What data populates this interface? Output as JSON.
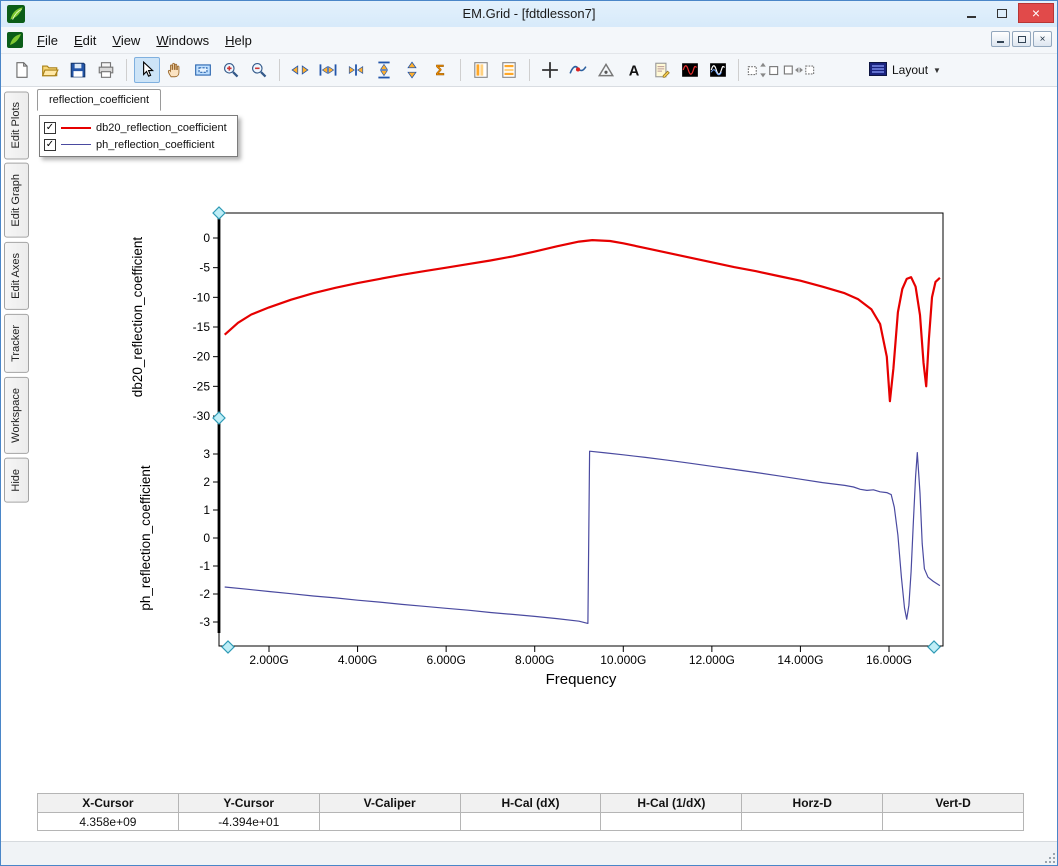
{
  "window": {
    "title": "EM.Grid - [fdtdlesson7]",
    "close_glyph": "×",
    "controls": [
      "minimize-icon",
      "maximize-icon",
      "close-icon"
    ],
    "mdi_controls": [
      "minimize-icon",
      "restore-icon",
      "close-icon"
    ]
  },
  "menu": {
    "items": [
      "File",
      "Edit",
      "View",
      "Windows",
      "Help"
    ]
  },
  "toolbar": {
    "layout_label": "Layout",
    "icons": [
      {
        "name": "new-file-icon",
        "kind": "new"
      },
      {
        "name": "open-file-icon",
        "kind": "open"
      },
      {
        "name": "save-icon",
        "kind": "save"
      },
      {
        "name": "print-icon",
        "kind": "print"
      },
      {
        "kind": "sep"
      },
      {
        "name": "select-cursor-icon",
        "kind": "cursor",
        "selected": true
      },
      {
        "name": "pan-hand-icon",
        "kind": "hand"
      },
      {
        "name": "zoom-region-icon",
        "kind": "zoomrect"
      },
      {
        "name": "zoom-in-icon",
        "kind": "zoomin"
      },
      {
        "name": "zoom-out-icon",
        "kind": "zoomout"
      },
      {
        "kind": "sep"
      },
      {
        "name": "fit-horizontal-icon",
        "kind": "harrow"
      },
      {
        "name": "expand-horizontal-icon",
        "kind": "harrowbars"
      },
      {
        "name": "collapse-horizontal-icon",
        "kind": "harrowedge"
      },
      {
        "name": "expand-vertical-icon",
        "kind": "vexpand"
      },
      {
        "name": "fit-vertical-icon",
        "kind": "varrow"
      },
      {
        "name": "autoscale-sigma-icon",
        "kind": "sigma"
      },
      {
        "kind": "sep"
      },
      {
        "name": "column-layout-icon",
        "kind": "coldoc"
      },
      {
        "name": "row-layout-icon",
        "kind": "rowdoc"
      },
      {
        "kind": "sep"
      },
      {
        "name": "crosshair-icon",
        "kind": "cross"
      },
      {
        "name": "curve-marker-icon",
        "kind": "curve"
      },
      {
        "name": "delta-marker-icon",
        "kind": "tri"
      },
      {
        "name": "text-annotation-icon",
        "kind": "textA"
      },
      {
        "name": "notes-icon",
        "kind": "note"
      },
      {
        "name": "dark-trace-red-icon",
        "kind": "waveR"
      },
      {
        "name": "dark-trace-white-icon",
        "kind": "waveW"
      },
      {
        "kind": "sep"
      },
      {
        "name": "vertical-span-boxes-icon",
        "kind": "checkv"
      },
      {
        "name": "horizontal-span-boxes-icon",
        "kind": "checkh"
      },
      {
        "kind": "gap"
      },
      {
        "name": "layout-dropdown",
        "kind": "layout"
      }
    ]
  },
  "sidebar": {
    "tabs": [
      {
        "label": "Edit Plots",
        "name": "sidebar-tab-edit-plots"
      },
      {
        "label": "Edit Graph",
        "name": "sidebar-tab-edit-graph"
      },
      {
        "label": "Edit Axes",
        "name": "sidebar-tab-edit-axes"
      },
      {
        "label": "Tracker",
        "name": "sidebar-tab-tracker"
      },
      {
        "label": "Workspace",
        "name": "sidebar-tab-workspace"
      },
      {
        "label": "Hide",
        "name": "sidebar-tab-hide"
      }
    ]
  },
  "tabs": {
    "active": "reflection_coefficient"
  },
  "legend": {
    "entries": [
      {
        "label": "db20_reflection_coefficient",
        "color": "#e60000",
        "checked": true,
        "line_width": 2.5,
        "check_glyph": "✓"
      },
      {
        "label": "ph_reflection_coefficient",
        "color": "#4a4aa0",
        "checked": true,
        "line_width": 1.3,
        "check_glyph": "✓"
      }
    ]
  },
  "chart_data": {
    "type": "line",
    "x_axis": {
      "label": "Frequency",
      "tick_labels": [
        "2.000G",
        "4.000G",
        "6.000G",
        "8.000G",
        "10.000G",
        "12.000G",
        "14.000G",
        "16.000G"
      ],
      "tick_values_ghz": [
        2,
        4,
        6,
        8,
        10,
        12,
        14,
        16
      ],
      "range_ghz": [
        0.87,
        17.22
      ]
    },
    "panels": [
      {
        "ylabel": "db20_reflection_coefficient",
        "yticks": [
          0,
          -5,
          -10,
          -15,
          -20,
          -25,
          -30
        ],
        "ylim": [
          -30,
          2
        ]
      },
      {
        "ylabel": "ph_reflection_coefficient",
        "yticks": [
          3,
          2,
          1,
          0,
          -1,
          -2,
          -3
        ],
        "ylim": [
          -3.5,
          3.5
        ]
      }
    ],
    "series": [
      {
        "name": "db20_reflection_coefficient",
        "panel": 0,
        "color": "#e60000",
        "width": 2.2,
        "points": [
          [
            1.0,
            -16.3
          ],
          [
            1.3,
            -14.3
          ],
          [
            1.6,
            -12.9
          ],
          [
            2.0,
            -11.7
          ],
          [
            2.5,
            -10.4
          ],
          [
            3.0,
            -9.3
          ],
          [
            3.5,
            -8.4
          ],
          [
            4.0,
            -7.6
          ],
          [
            4.5,
            -6.9
          ],
          [
            5.0,
            -6.2
          ],
          [
            5.5,
            -5.6
          ],
          [
            6.0,
            -5.0
          ],
          [
            6.5,
            -4.4
          ],
          [
            7.0,
            -3.8
          ],
          [
            7.5,
            -3.1
          ],
          [
            8.0,
            -2.3
          ],
          [
            8.5,
            -1.4
          ],
          [
            9.0,
            -0.6
          ],
          [
            9.3,
            -0.35
          ],
          [
            9.7,
            -0.5
          ],
          [
            10.0,
            -0.9
          ],
          [
            10.5,
            -1.7
          ],
          [
            11.0,
            -2.5
          ],
          [
            11.5,
            -3.3
          ],
          [
            12.0,
            -4.1
          ],
          [
            12.5,
            -4.9
          ],
          [
            13.0,
            -5.6
          ],
          [
            13.5,
            -6.4
          ],
          [
            14.0,
            -7.2
          ],
          [
            14.5,
            -8.2
          ],
          [
            15.0,
            -9.3
          ],
          [
            15.3,
            -10.3
          ],
          [
            15.6,
            -12.0
          ],
          [
            15.8,
            -14.5
          ],
          [
            15.95,
            -20.0
          ],
          [
            16.02,
            -27.5
          ],
          [
            16.1,
            -22.0
          ],
          [
            16.2,
            -12.5
          ],
          [
            16.3,
            -8.6
          ],
          [
            16.4,
            -6.9
          ],
          [
            16.5,
            -6.6
          ],
          [
            16.6,
            -8.2
          ],
          [
            16.7,
            -13.0
          ],
          [
            16.78,
            -21.0
          ],
          [
            16.84,
            -25.0
          ],
          [
            16.9,
            -17.0
          ],
          [
            16.97,
            -10.0
          ],
          [
            17.05,
            -7.4
          ],
          [
            17.15,
            -6.7
          ]
        ]
      },
      {
        "name": "ph_reflection_coefficient",
        "panel": 1,
        "color": "#4a4aa0",
        "width": 1.2,
        "points": [
          [
            1.0,
            -1.75
          ],
          [
            1.5,
            -1.83
          ],
          [
            2.0,
            -1.91
          ],
          [
            2.5,
            -1.99
          ],
          [
            3.0,
            -2.07
          ],
          [
            3.5,
            -2.14
          ],
          [
            4.0,
            -2.22
          ],
          [
            4.5,
            -2.29
          ],
          [
            5.0,
            -2.37
          ],
          [
            5.5,
            -2.44
          ],
          [
            6.0,
            -2.51
          ],
          [
            6.5,
            -2.58
          ],
          [
            7.0,
            -2.66
          ],
          [
            7.5,
            -2.73
          ],
          [
            8.0,
            -2.8
          ],
          [
            8.5,
            -2.88
          ],
          [
            9.0,
            -2.97
          ],
          [
            9.2,
            -3.05
          ],
          [
            9.24,
            3.1
          ],
          [
            9.6,
            3.04
          ],
          [
            10.0,
            2.97
          ],
          [
            10.5,
            2.88
          ],
          [
            11.0,
            2.78
          ],
          [
            11.5,
            2.67
          ],
          [
            12.0,
            2.56
          ],
          [
            12.5,
            2.45
          ],
          [
            13.0,
            2.34
          ],
          [
            13.5,
            2.22
          ],
          [
            14.0,
            2.1
          ],
          [
            14.5,
            1.98
          ],
          [
            15.0,
            1.88
          ],
          [
            15.2,
            1.82
          ],
          [
            15.35,
            1.74
          ],
          [
            15.5,
            1.7
          ],
          [
            15.65,
            1.72
          ],
          [
            15.8,
            1.65
          ],
          [
            15.95,
            1.62
          ],
          [
            16.05,
            1.55
          ],
          [
            16.12,
            1.1
          ],
          [
            16.2,
            0.1
          ],
          [
            16.28,
            -1.4
          ],
          [
            16.35,
            -2.5
          ],
          [
            16.4,
            -2.9
          ],
          [
            16.45,
            -2.4
          ],
          [
            16.5,
            -1.2
          ],
          [
            16.55,
            0.6
          ],
          [
            16.6,
            2.2
          ],
          [
            16.64,
            3.05
          ],
          [
            16.7,
            1.6
          ],
          [
            16.75,
            -0.2
          ],
          [
            16.8,
            -1.1
          ],
          [
            16.88,
            -1.4
          ],
          [
            17.0,
            -1.55
          ],
          [
            17.15,
            -1.7
          ]
        ]
      }
    ]
  },
  "status_table": {
    "columns": [
      "X-Cursor",
      "Y-Cursor",
      "V-Caliper",
      "H-Cal (dX)",
      "H-Cal (1/dX)",
      "Horz-D",
      "Vert-D"
    ],
    "values": [
      "4.358e+09",
      "-4.394e+01",
      "",
      "",
      "",
      "",
      ""
    ]
  }
}
